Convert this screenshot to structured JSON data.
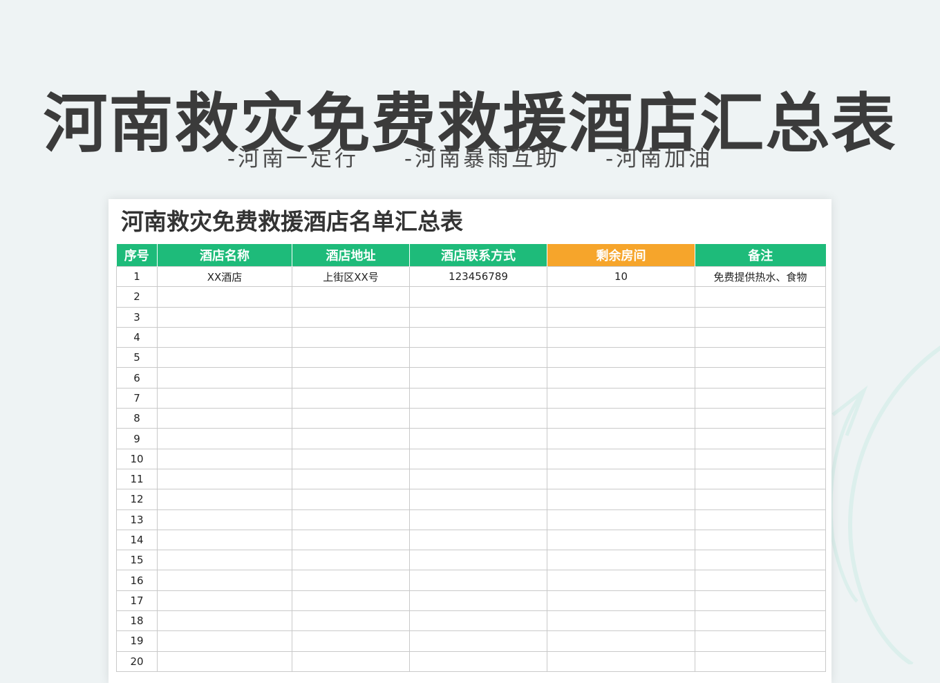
{
  "title": "河南救灾免费救援酒店汇总表",
  "taglines": [
    "-河南一定行",
    "-河南暴雨互助",
    "-河南加油"
  ],
  "sheet": {
    "title": "河南救灾免费救援酒店名单汇总表",
    "headers": [
      "序号",
      "酒店名称",
      "酒店地址",
      "酒店联系方式",
      "剩余房间",
      "备注"
    ],
    "rows": [
      [
        "1",
        "XX酒店",
        "上街区XX号",
        "123456789",
        "10",
        "免费提供热水、食物"
      ],
      [
        "2",
        "",
        "",
        "",
        "",
        ""
      ],
      [
        "3",
        "",
        "",
        "",
        "",
        ""
      ],
      [
        "4",
        "",
        "",
        "",
        "",
        ""
      ],
      [
        "5",
        "",
        "",
        "",
        "",
        ""
      ],
      [
        "6",
        "",
        "",
        "",
        "",
        ""
      ],
      [
        "7",
        "",
        "",
        "",
        "",
        ""
      ],
      [
        "8",
        "",
        "",
        "",
        "",
        ""
      ],
      [
        "9",
        "",
        "",
        "",
        "",
        ""
      ],
      [
        "10",
        "",
        "",
        "",
        "",
        ""
      ],
      [
        "11",
        "",
        "",
        "",
        "",
        ""
      ],
      [
        "12",
        "",
        "",
        "",
        "",
        ""
      ],
      [
        "13",
        "",
        "",
        "",
        "",
        ""
      ],
      [
        "14",
        "",
        "",
        "",
        "",
        ""
      ],
      [
        "15",
        "",
        "",
        "",
        "",
        ""
      ],
      [
        "16",
        "",
        "",
        "",
        "",
        ""
      ],
      [
        "17",
        "",
        "",
        "",
        "",
        ""
      ],
      [
        "18",
        "",
        "",
        "",
        "",
        ""
      ],
      [
        "19",
        "",
        "",
        "",
        "",
        ""
      ],
      [
        "20",
        "",
        "",
        "",
        "",
        ""
      ]
    ]
  },
  "colors": {
    "background": "#eef3f4",
    "header_green": "#1ebb7a",
    "header_orange": "#f6a52b",
    "title_text": "#3b3b3b"
  }
}
